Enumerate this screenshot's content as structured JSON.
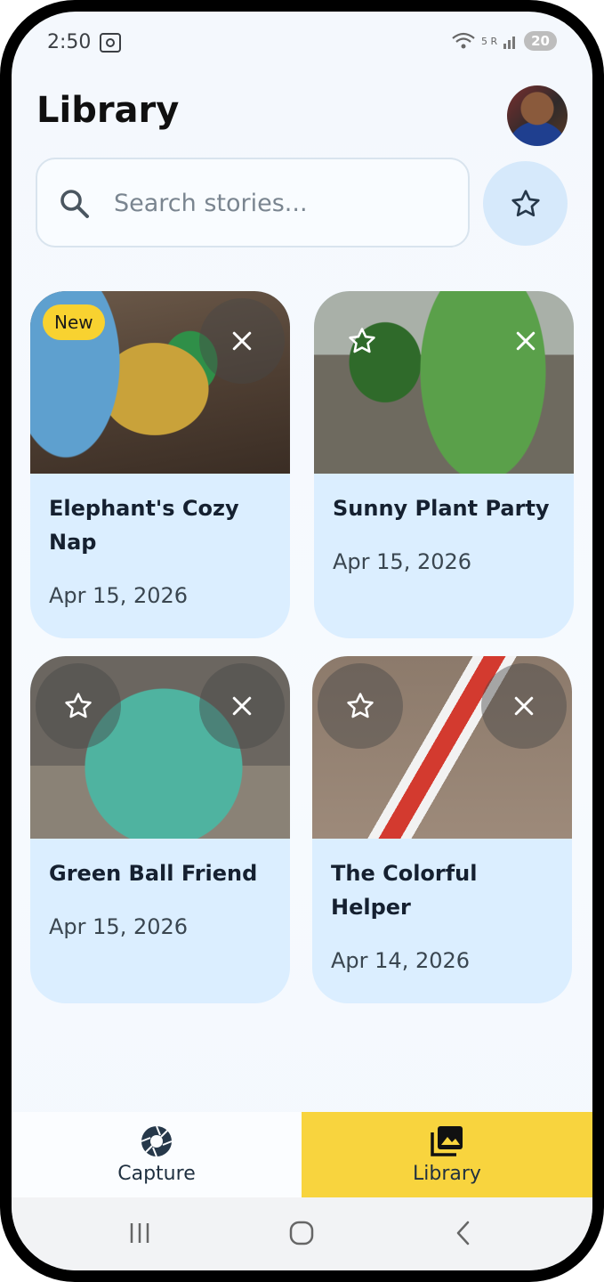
{
  "status_bar": {
    "time": "2:50",
    "battery": "20",
    "network": "5 R"
  },
  "header": {
    "title": "Library"
  },
  "search": {
    "placeholder": "Search stories..."
  },
  "cards": [
    {
      "title": "Elephant's Cozy Nap",
      "date": "Apr 15, 2026",
      "badge": "New"
    },
    {
      "title": "Sunny Plant Party",
      "date": "Apr 15, 2026"
    },
    {
      "title": "Green Ball Friend",
      "date": "Apr 15, 2026"
    },
    {
      "title": "The Colorful Helper",
      "date": "Apr 14, 2026"
    }
  ],
  "bottom_nav": {
    "capture_label": "Capture",
    "library_label": "Library",
    "active": "Library"
  },
  "colors": {
    "accent": "#f8d43e",
    "card_bg": "#dbeeff",
    "fav_bg": "#d6e9fb",
    "badge": "#f8d230"
  }
}
